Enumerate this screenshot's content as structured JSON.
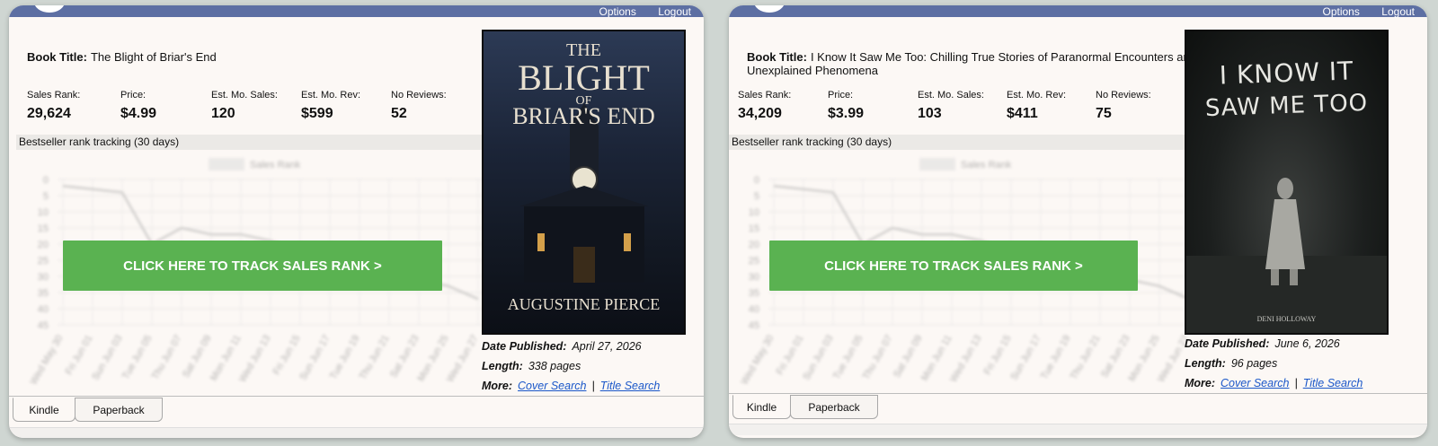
{
  "topbar": {
    "options_label": "Options",
    "logout_label": "Logout"
  },
  "labels": {
    "book_title": "Book Title:",
    "sales_rank": "Sales Rank:",
    "price": "Price:",
    "est_mo_sales": "Est. Mo. Sales:",
    "est_mo_rev": "Est. Mo. Rev:",
    "no_reviews": "No Reviews:",
    "tracking_header": "Bestseller rank tracking (30 days)",
    "cta": "CLICK HERE TO TRACK SALES RANK >",
    "date_published": "Date Published:",
    "length": "Length:",
    "more": "More:",
    "cover_search": "Cover Search",
    "title_search": "Title Search",
    "tab_kindle": "Kindle",
    "tab_paperback": "Paperback"
  },
  "chart": {
    "legend": "Sales Rank",
    "y_ticks": [
      "0",
      "5",
      "10",
      "15",
      "20",
      "25",
      "30",
      "35",
      "40",
      "45"
    ],
    "x_ticks": [
      "Wed May 30",
      "Fri Jun 01",
      "Sun Jun 03",
      "Tue Jun 05",
      "Thu Jun 07",
      "Sat Jun 09",
      "Mon Jun 11",
      "Wed Jun 13",
      "Fri Jun 15",
      "Sun Jun 17",
      "Tue Jun 19",
      "Thu Jun 21",
      "Sat Jun 23",
      "Mon Jun 25",
      "Wed Jun 27"
    ]
  },
  "books": [
    {
      "title": "The Blight of Briar's End",
      "sales_rank": "29,624",
      "price": "$4.99",
      "est_mo_sales": "120",
      "est_mo_rev": "$599",
      "no_reviews": "52",
      "date_published": "April 27, 2026",
      "length": "338 pages",
      "cover": {
        "line1": "THE",
        "line2": "BLIGHT",
        "line3": "OF",
        "line4": "BRIAR'S END",
        "author": "AUGUSTINE PIERCE"
      }
    },
    {
      "title": "I Know It Saw Me Too: Chilling True Stories of Paranormal Encounters and Unexplained Phenomena",
      "sales_rank": "34,209",
      "price": "$3.99",
      "est_mo_sales": "103",
      "est_mo_rev": "$411",
      "no_reviews": "75",
      "date_published": "June 6, 2026",
      "length": "96 pages",
      "cover": {
        "line1": "I KNOW IT",
        "line2": "SAW ME TOO",
        "author": "DENI HOLLOWAY"
      }
    }
  ],
  "colors": {
    "topbar": "#5d6fa3",
    "cta": "#5ab251",
    "link": "#1a57c9",
    "panel": "#fcf8f5"
  }
}
